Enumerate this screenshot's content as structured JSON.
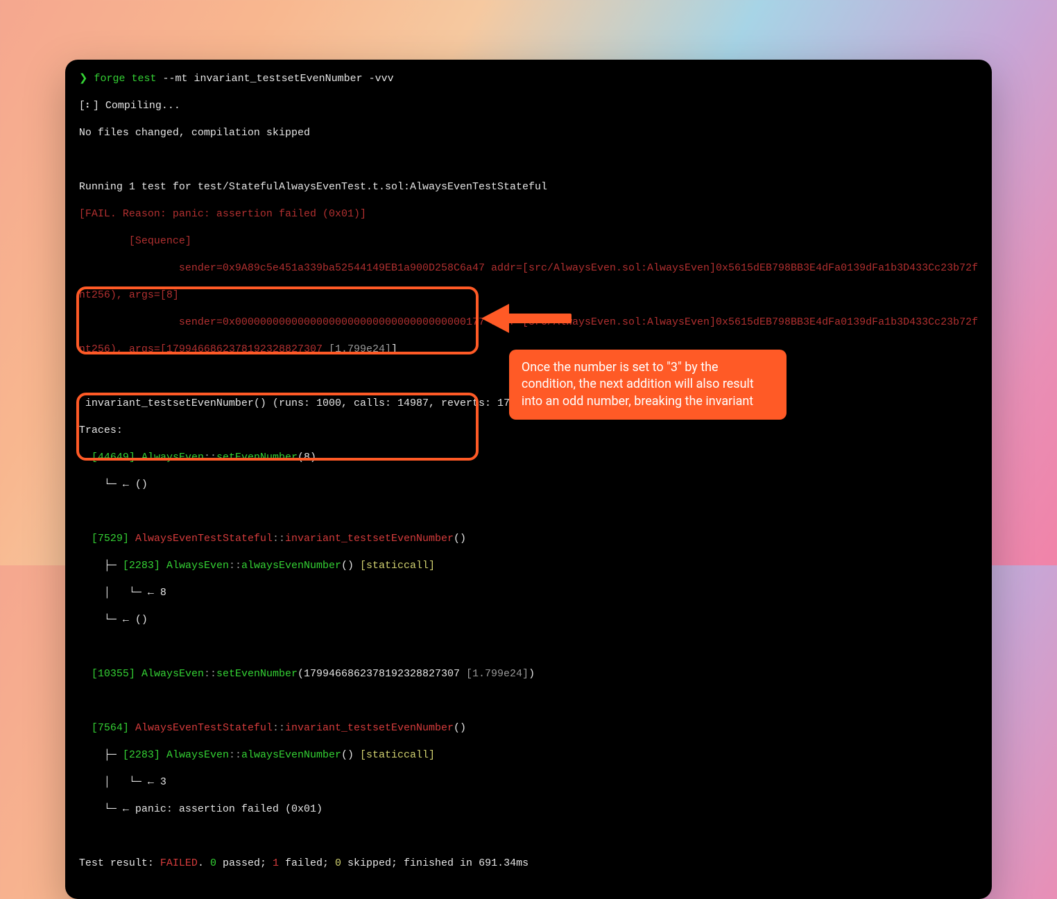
{
  "cmd": {
    "prompt": "❯",
    "bin": "forge",
    "sub": "test",
    "args": "--mt invariant_testsetEvenNumber -vvv"
  },
  "compile": {
    "spinner": "[⠆] Compiling...",
    "msg": "No files changed, compilation skipped"
  },
  "run": "Running 1 test for test/StatefulAlwaysEvenTest.t.sol:AlwaysEvenTestStateful",
  "fail": "[FAIL. Reason: panic: assertion failed (0x01)]",
  "seq": "[Sequence]",
  "s1": {
    "pre": "                sender=0x9A89c5e451a339ba52544149EB1a900D258C6a47 addr=[src/AlwaysEven.sol:AlwaysEven]0x5615dEB798BB3E4dFa0139dFa1b3D433Cc23b72f",
    "tail": "nt256), args=[8]"
  },
  "s2": {
    "pre": "                sender=0x0000000000000000000000000000000000000177 addr=[src/AlwaysEven.sol:AlwaysEven]0x5615dEB798BB3E4dFa0139dFa1b3D433Cc23b72f",
    "tail1": "nt256), args=[1799466862378192328827307 ",
    "grey": "[1.799e24]",
    "tail2": "]"
  },
  "stats": " invariant_testsetEvenNumber() (runs: 1000, calls: 14987, reverts: 1705)",
  "traces": "Traces:",
  "t0": {
    "gas": "[44649]",
    "cls": "AlwaysEven",
    "fn": "setEvenNumber",
    "arg": "(8)",
    "ret": "    └─ ← ()"
  },
  "tA": {
    "gas": "[7529]",
    "cls": "AlwaysEvenTestStateful",
    "fn": "invariant_testsetEvenNumber",
    "arg": "()",
    "c_gas": "[2283]",
    "c_cls": "AlwaysEven",
    "c_fn": "alwaysEvenNumber",
    "c_arg": "()",
    "c_tag": "[staticcall]",
    "r1": "    │   └─ ← 8",
    "r2": "    └─ ← ()"
  },
  "t1": {
    "gas": "[10355]",
    "cls": "AlwaysEven",
    "fn": "setEvenNumber",
    "arg": "(1799466862378192328827307 ",
    "grey": "[1.799e24]",
    "tail": ")"
  },
  "tB": {
    "gas": "[7564]",
    "cls": "AlwaysEvenTestStateful",
    "fn": "invariant_testsetEvenNumber",
    "arg": "()",
    "c_gas": "[2283]",
    "c_cls": "AlwaysEven",
    "c_fn": "alwaysEvenNumber",
    "c_arg": "()",
    "c_tag": "[staticcall]",
    "r1": "    │   └─ ← 3",
    "r2": "    └─ ← panic: assertion failed (0x01)"
  },
  "result": {
    "pre": "Test result: ",
    "failed": "FAILED",
    "dot": ". ",
    "p": "0",
    "ptxt": " passed; ",
    "f": "1",
    "ftxt": " failed; ",
    "s": "0",
    "stxt": " skipped; finished in 691.34ms"
  },
  "note": "Once the number is set to \"3\" by the condition, the next addition will also result into an odd number, breaking the invariant"
}
